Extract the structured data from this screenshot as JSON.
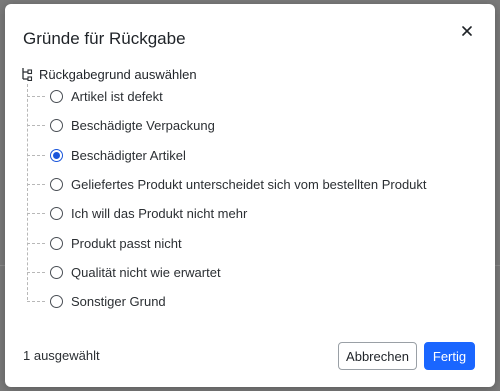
{
  "dialog": {
    "title": "Gründe für Rückgabe",
    "close_icon": "close-icon"
  },
  "group": {
    "icon": "tree-icon",
    "label": "Rückgabegrund auswählen",
    "options": [
      {
        "label": "Artikel ist defekt",
        "checked": false
      },
      {
        "label": "Beschädigte Verpackung",
        "checked": false
      },
      {
        "label": "Beschädigter Artikel",
        "checked": true
      },
      {
        "label": "Geliefertes Produkt unterscheidet sich vom bestellten Produkt",
        "checked": false
      },
      {
        "label": "Ich will das Produkt nicht mehr",
        "checked": false
      },
      {
        "label": "Produkt passt nicht",
        "checked": false
      },
      {
        "label": "Qualität nicht wie erwartet",
        "checked": false
      },
      {
        "label": "Sonstiger Grund",
        "checked": false
      }
    ]
  },
  "footer": {
    "status": "1 ausgewählt",
    "cancel_label": "Abbrechen",
    "done_label": "Fertig"
  },
  "colors": {
    "primary": "#1a66ff",
    "radio_checked": "#1a56db"
  }
}
